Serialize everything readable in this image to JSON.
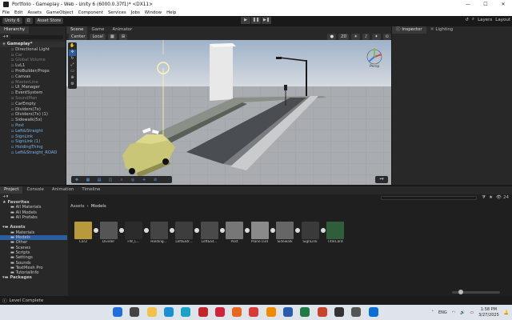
{
  "window": {
    "title": "Portfolio - Gameplay - Web - Unity 6 (6000.0.37f1)* <DX11>",
    "min": "—",
    "max": "☐",
    "close": "✕"
  },
  "menu": [
    "File",
    "Edit",
    "Assets",
    "GameObject",
    "Component",
    "Services",
    "Jobs",
    "Window",
    "Help"
  ],
  "toolbar": {
    "account": "Unity 6",
    "cloud": "Ω",
    "asset_store": "Asset Store",
    "play": "▶",
    "pause": "❚❚",
    "step": "▶❚",
    "layers": "Layers",
    "layout": "Layout",
    "search": "⌕"
  },
  "hierarchy": {
    "tab": "Hierarchy",
    "items": [
      {
        "label": "Gameplay*",
        "indent": 0,
        "style": "bold"
      },
      {
        "label": "Directional Light",
        "indent": 1,
        "style": "normal"
      },
      {
        "label": "Car",
        "indent": 1,
        "style": "dim"
      },
      {
        "label": "Global Volume",
        "indent": 1,
        "style": "dim"
      },
      {
        "label": "LvL1",
        "indent": 1,
        "style": "normal"
      },
      {
        "label": "ProBuilder/Props",
        "indent": 1,
        "style": "normal"
      },
      {
        "label": "Canvas",
        "indent": 1,
        "style": "normal"
      },
      {
        "label": "MasterLine",
        "indent": 1,
        "style": "dim"
      },
      {
        "label": "UI_Manager",
        "indent": 1,
        "style": "normal"
      },
      {
        "label": "EventSystem",
        "indent": 1,
        "style": "normal"
      },
      {
        "label": "SoundMan",
        "indent": 1,
        "style": "dim"
      },
      {
        "label": "CarEmpty",
        "indent": 1,
        "style": "normal"
      },
      {
        "label": "Dividers(7x)",
        "indent": 1,
        "style": "normal"
      },
      {
        "label": "Dividers(7x) (1)",
        "indent": 1,
        "style": "normal"
      },
      {
        "label": "Sidewalk(5x)",
        "indent": 1,
        "style": "normal"
      },
      {
        "label": "Post",
        "indent": 1,
        "style": "prefab"
      },
      {
        "label": "Left&Straight",
        "indent": 1,
        "style": "prefab"
      },
      {
        "label": "SignLink",
        "indent": 1,
        "style": "prefab"
      },
      {
        "label": "SignLink (1)",
        "indent": 1,
        "style": "prefab"
      },
      {
        "label": "HoldingThing",
        "indent": 1,
        "style": "prefab"
      },
      {
        "label": "Left&Straight_ROAD",
        "indent": 1,
        "style": "prefab"
      }
    ]
  },
  "scene": {
    "tabs": [
      "Scene",
      "Game",
      "Animator"
    ],
    "pivot": "Center",
    "space": "Local",
    "persp_label": "Persp"
  },
  "inspector": {
    "tabs": [
      "Inspector",
      "Lighting"
    ]
  },
  "project": {
    "tabs": [
      "Project",
      "Console",
      "Animation",
      "Timeline"
    ],
    "count": "24",
    "breadcrumb": [
      "Assets",
      "Models"
    ],
    "tree": [
      {
        "label": "Favorites",
        "indent": 0,
        "bold": true
      },
      {
        "label": "All Materials",
        "indent": 1
      },
      {
        "label": "All Models",
        "indent": 1
      },
      {
        "label": "All Prefabs",
        "indent": 1
      },
      {
        "label": "",
        "indent": 0
      },
      {
        "label": "Assets",
        "indent": 0,
        "bold": true
      },
      {
        "label": "Materials",
        "indent": 1
      },
      {
        "label": "Models",
        "indent": 1,
        "selected": true
      },
      {
        "label": "Other",
        "indent": 1
      },
      {
        "label": "Scenes",
        "indent": 1
      },
      {
        "label": "Scripts",
        "indent": 1
      },
      {
        "label": "Settings",
        "indent": 1
      },
      {
        "label": "Sounds",
        "indent": 1
      },
      {
        "label": "TextMesh Pro",
        "indent": 1
      },
      {
        "label": "TutorialInfo",
        "indent": 1
      },
      {
        "label": "Packages",
        "indent": 0,
        "bold": true
      }
    ],
    "assets": [
      "Car2",
      "Divider",
      "FW_L...",
      "Holding...",
      "Left&Str...",
      "Left&St...",
      "Post",
      "Plane.034",
      "Sidewalk",
      "SignLink",
      "TitleCard"
    ]
  },
  "status": {
    "text": "Level Complete"
  },
  "taskbar": {
    "lang": "ENG",
    "time": "1:58 PM",
    "date": "3/27/2025",
    "icons": [
      "windows",
      "search",
      "explorer",
      "edge",
      "vscode-cyan",
      "unity-red",
      "opera",
      "firefox",
      "chrome-red",
      "vlc",
      "word",
      "excel",
      "powerpoint",
      "unity",
      "unity-hub",
      "vs"
    ]
  },
  "colors": {
    "accent": "#2c5d9e",
    "prefab": "#7fb3ea",
    "selection": "#2c5d9e"
  }
}
